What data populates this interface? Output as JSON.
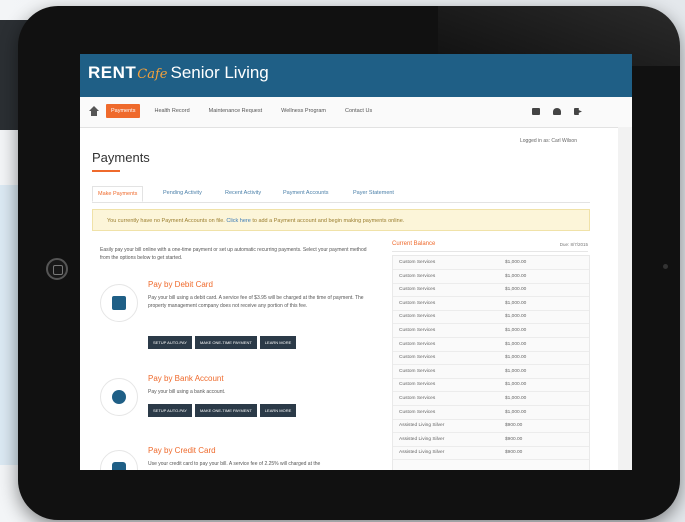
{
  "brand": {
    "rent": "RENT",
    "cafe": "Cafe",
    "sub": "Senior Living"
  },
  "nav": {
    "items": [
      "Payments",
      "Health Record",
      "Maintenance Request",
      "Wellness Program",
      "Contact Us"
    ]
  },
  "user": {
    "logged_in": "Logged in as: Carl Wilson"
  },
  "page": {
    "title": "Payments"
  },
  "tabs": [
    "Make Payments",
    "Pending Activity",
    "Recent Activity",
    "Payment Accounts",
    "Payer Statement"
  ],
  "alert": {
    "text_before": "You currently have no Payment Accounts on file. ",
    "link": "Click here",
    "text_after": " to add a Payment account and begin making payments online."
  },
  "intro": "Easily pay your bill online with a one-time payment or set up automatic recurring payments. Select your payment method from the options below to get started.",
  "methods": [
    {
      "title": "Pay by Debit Card",
      "desc": "Pay your bill using a debit card. A service fee of $3.95 will be charged at the time of payment. The property management company does not receive any portion of this fee.",
      "buttons": [
        "SETUP AUTO-PAY",
        "MAKE ONE-TIME PAYMENT",
        "LEARN MORE"
      ]
    },
    {
      "title": "Pay by Bank Account",
      "desc": "Pay your bill using a bank account.",
      "buttons": [
        "SETUP AUTO-PAY",
        "MAKE ONE-TIME PAYMENT",
        "LEARN MORE"
      ]
    },
    {
      "title": "Pay by Credit Card",
      "desc": "Use your credit card to pay your bill. A service fee of 2.25% will charged at the",
      "buttons": []
    }
  ],
  "balance": {
    "title": "Current Balance",
    "date": "Due: 8/7/2015",
    "rows": [
      {
        "label": "Custom Services",
        "amount": "$1,000.00"
      },
      {
        "label": "Custom Services",
        "amount": "$1,000.00"
      },
      {
        "label": "Custom Services",
        "amount": "$1,000.00"
      },
      {
        "label": "Custom Services",
        "amount": "$1,000.00"
      },
      {
        "label": "Custom Services",
        "amount": "$1,000.00"
      },
      {
        "label": "Custom Services",
        "amount": "$1,000.00"
      },
      {
        "label": "Custom Services",
        "amount": "$1,000.00"
      },
      {
        "label": "Custom Services",
        "amount": "$1,000.00"
      },
      {
        "label": "Custom Services",
        "amount": "$1,000.00"
      },
      {
        "label": "Custom Services",
        "amount": "$1,000.00"
      },
      {
        "label": "Custom Services",
        "amount": "$1,000.00"
      },
      {
        "label": "Custom Services",
        "amount": "$1,000.00"
      },
      {
        "label": "Assisted Living Silver",
        "amount": "$900.00"
      },
      {
        "label": "Assisted Living Silver",
        "amount": "$900.00"
      },
      {
        "label": "Assisted Living Silver",
        "amount": "$900.00"
      }
    ]
  },
  "colors": {
    "brand_blue": "#1f5f86",
    "accent_orange": "#ef6a2c",
    "button_dark": "#2b3a48"
  }
}
